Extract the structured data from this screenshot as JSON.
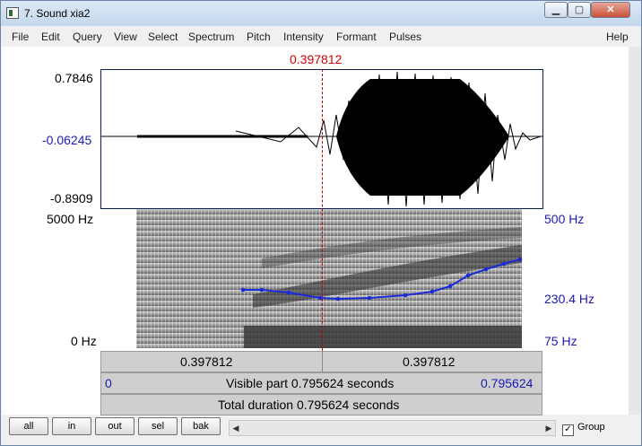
{
  "window": {
    "title": "7. Sound xia2",
    "controls": {
      "minimize": "▁",
      "maximize": "▢",
      "close": "✕"
    }
  },
  "menu": [
    "File",
    "Edit",
    "Query",
    "View",
    "Select",
    "Spectrum",
    "Pitch",
    "Intensity",
    "Formant",
    "Pulses",
    "Help"
  ],
  "cursor": {
    "time_label": "0.397812"
  },
  "waveform": {
    "ymax_label": "0.7846",
    "ycursor_label": "-0.06245",
    "ymin_label": "-0.8909"
  },
  "spectrogram": {
    "freq_max_label": "5000 Hz",
    "freq_min_label": "0 Hz",
    "pitch_max_label": "500 Hz",
    "pitch_mid_label": "230.4 Hz",
    "pitch_min_label": "75 Hz",
    "pitch_color": "#1a2ad8"
  },
  "bars": {
    "left_time": "0.397812",
    "right_time": "0.397812",
    "visible_start": "0",
    "visible_text": "Visible part 0.795624 seconds",
    "visible_end": "0.795624",
    "total_text": "Total duration 0.795624 seconds"
  },
  "buttons": {
    "all": "all",
    "in": "in",
    "out": "out",
    "sel": "sel",
    "bak": "bak"
  },
  "scroll": {
    "left_arrow": "◀",
    "right_arrow": "▶"
  },
  "group": {
    "label": "Group",
    "checked": "✓"
  },
  "colors": {
    "cursor_red": "#d40000",
    "axis_blue": "#1a1ab5",
    "bar_gray": "#cfcfcf"
  }
}
